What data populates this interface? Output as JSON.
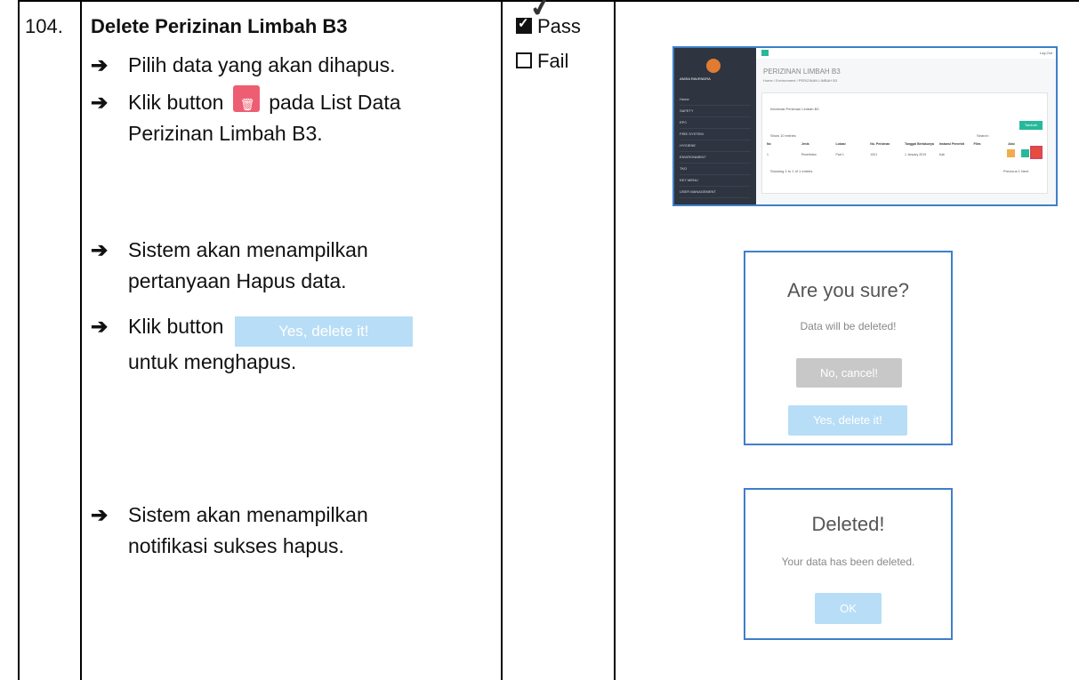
{
  "row": {
    "number": "104.",
    "title": "Delete Perizinan Limbah B3"
  },
  "steps": {
    "s1": "Pilih data yang akan dihapus.",
    "s2_before": "Klik button",
    "s2_after": "pada List Data",
    "s2_cont": "Perizinan Limbah B3.",
    "s3_line1": "Sistem akan menampilkan",
    "s3_line2": "pertanyaan Hapus data.",
    "s4_before": "Klik button",
    "s4_button": "Yes, delete it!",
    "s4_cont": "untuk menghapus.",
    "s5_line1": "Sistem akan menampilkan",
    "s5_line2": "notifikasi sukses hapus.",
    "arrow": "➔"
  },
  "result": {
    "pass": "Pass",
    "fail": "Fail",
    "pass_checked": true
  },
  "mini_app": {
    "page_title": "PERIZINAN LIMBAH B3",
    "breadcrumb": "Home / Environment / PERIZINAN LIMBAH B3",
    "logout": "Log Out",
    "user": "ANISA RAVENDRA",
    "menu": [
      "Home",
      "SAFETY",
      "EPC",
      "FIRE SYSTEM",
      "HYGIENE",
      "ENVIRONMENT",
      "TKO",
      "KEY MENU",
      "USER MANAGEMENT"
    ],
    "section": "Informasi Perizinan Limbah B3",
    "add_button": "Tambah",
    "show": "Show 10 entries",
    "search": "Search:",
    "columns": [
      "No",
      "Jenis",
      "Lokasi",
      "No. Perizinan",
      "Tanggal Berlakunya",
      "Instansi Penerbit",
      "Files",
      "Aksi"
    ],
    "row1": [
      "1",
      "Penerbitan",
      "Part 1",
      "1001",
      "1 January 2019",
      "Kab",
      "",
      ""
    ],
    "showing": "Showing 1 to 1 of 1 entries",
    "pager": "Previous 1 Next"
  },
  "confirm_dialog": {
    "title": "Are you sure?",
    "text": "Data will be deleted!",
    "cancel": "No, cancel!",
    "confirm": "Yes, delete it!"
  },
  "success_dialog": {
    "title": "Deleted!",
    "text": "Your data has been deleted.",
    "ok": "OK"
  },
  "colors": {
    "confirm_button": "#b8ddf6",
    "cancel_button": "#c8c8c8",
    "delete_button": "#ee5e72",
    "frame": "#3f7fc8"
  }
}
